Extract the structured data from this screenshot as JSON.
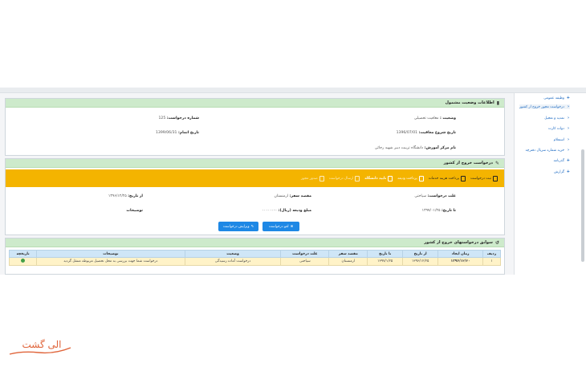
{
  "panel_status": {
    "title": "اطلاعات وضعیت مشمول",
    "status_label": "وضعیت :",
    "status_value": "معافیت تحصیلی",
    "request_no_label": "شماره درخواست:",
    "request_no_value": "125",
    "start_label": "تاریخ شروع معافیت:",
    "start_value": "1396/07/01",
    "end_label": "تاریخ اتمام:",
    "end_value": "1399/06/31",
    "center_label": "نام مرکز آموزش:",
    "center_value": "دانشگاه تربیت دبیر شهید رجائی"
  },
  "panel_request": {
    "title": "درخواست خروج از کشور",
    "steps": [
      {
        "label": "ثبت درخواست",
        "state": "done"
      },
      {
        "label": "پرداخت هزینه خدمات",
        "state": "done"
      },
      {
        "label": "پرداخت ودیعه",
        "state": "pending"
      },
      {
        "label": "تایید دانشگاه",
        "state": "current"
      },
      {
        "label": "ارسال درخواست",
        "state": "pending"
      },
      {
        "label": "صدور مجوز",
        "state": "pending"
      }
    ],
    "reason_label": "علت درخواست:",
    "reason_value": "سیاحتی",
    "dest_label": "مقصد سفر:",
    "dest_value": "ارمنستان",
    "from_label": "از تاریخ:",
    "from_value": "۱۳۹۶/۱۲/۲۵",
    "to_label": "تا تاریخ:",
    "to_value": "۱۳۹۷/۰۱/۲۵",
    "deposit_label": "مبلغ ودیعه (ریال):",
    "deposit_value": "۰-۰۰۰۰۰۰",
    "desc_label": "توضیحات",
    "cancel_button": "لغو درخواست",
    "edit_button": "ویرایش درخواست"
  },
  "panel_history": {
    "title": "سوابق درخواستهای خروج از کشور",
    "columns": [
      "ردیف",
      "زمان ایجاد",
      "از تاریخ",
      "تا تاریخ",
      "مقصد سفر",
      "علت درخواست",
      "وضعیت",
      "توضیحات",
      "تاریخچه"
    ],
    "rows": [
      [
        "۱",
        "۱۳۹۶/۱۲/۲۰",
        "۱۳۹۶/۱۲/۲۵",
        "۱۳۹۷/۱/۲۵",
        "ارمنستان",
        "سیاحتی",
        "درخواست آماده رسیدگی",
        "درخواست شما جهت بررسی به محل تحصیل مربوطه منتقل گردید"
      ]
    ]
  },
  "sidebar": {
    "items": [
      {
        "label": "وظیفه عمومی",
        "marker": "+"
      },
      {
        "label": "درخواست مجوز خروج از کشور",
        "marker": "‹",
        "active": true
      },
      {
        "label": "تمدید و تعجیل",
        "marker": "‹"
      },
      {
        "label": "دوات کارت",
        "marker": "‹"
      },
      {
        "label": "استعلام",
        "marker": "‹"
      },
      {
        "label": "خرید شماره سریال دفترچه",
        "marker": "‹"
      },
      {
        "label": "گذرنامه",
        "marker": "+"
      },
      {
        "label": "گزارش",
        "marker": "+"
      }
    ]
  },
  "logo_text": "الی گشت",
  "colors": {
    "accent_green": "#cdeacb",
    "wizard": "#f4b400",
    "button": "#1e88e5",
    "link": "#1565c0"
  }
}
